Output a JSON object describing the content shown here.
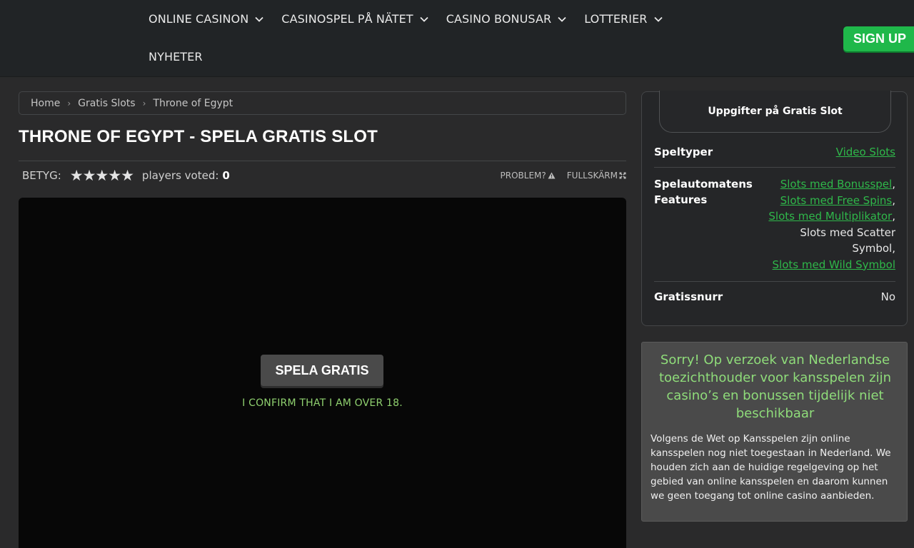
{
  "header": {
    "nav": [
      {
        "label": "ONLINE CASINON",
        "has_dropdown": true
      },
      {
        "label": "CASINOSPEL PÅ NÄTET",
        "has_dropdown": true
      },
      {
        "label": "CASINO BONUSAR",
        "has_dropdown": true
      },
      {
        "label": "LOTTERIER",
        "has_dropdown": true
      },
      {
        "label": "NYHETER",
        "has_dropdown": false
      }
    ],
    "signup_label": "SIGN UP"
  },
  "breadcrumb": [
    "Home",
    "Gratis Slots",
    "Throne of Egypt"
  ],
  "page_title": "THRONE OF EGYPT - SPELA GRATIS SLOT",
  "rating": {
    "label": "BETYG:",
    "stars": "★★★★★",
    "voted_label": "players voted:",
    "voted_count": "0",
    "problem_label": "PROBLEM?",
    "fullscreen_label": "FULLSKÄRM"
  },
  "game": {
    "play_label": "SPELA GRATIS",
    "confirm_text": "I CONFIRM THAT I AM OVER 18."
  },
  "info": {
    "tab_title": "Uppgifter på Gratis Slot",
    "speltyper_key": "Speltyper",
    "speltyper_val": "Video Slots",
    "features_key": "Spelautomatens Features",
    "features": {
      "f1": "Slots med Bonusspel",
      "f2": "Slots med Free Spins",
      "f3": "Slots med Multiplikator",
      "f4": "Slots med Scatter Symbol,",
      "f5": "Slots med Wild Symbol",
      "comma": ","
    },
    "gratissnurr_key": "Gratissnurr",
    "gratissnurr_val": "No"
  },
  "notice": {
    "title": "Sorry! Op verzoek van Nederlandse toezichthouder voor kansspelen zijn casino’s en bonussen tijdelijk niet beschikbaar",
    "body": "Volgens de Wet op Kansspelen zijn online kansspelen nog niet toegestaan in Nederland. We houden zich aan de huidige regelgeving op het gebied van online kansspelen en daarom kunnen we geen toegang tot online casino aanbieden."
  },
  "colors": {
    "accent_green": "#2fb84a",
    "signup_green": "#1fb84a",
    "notice_green": "#8fdc7a"
  }
}
